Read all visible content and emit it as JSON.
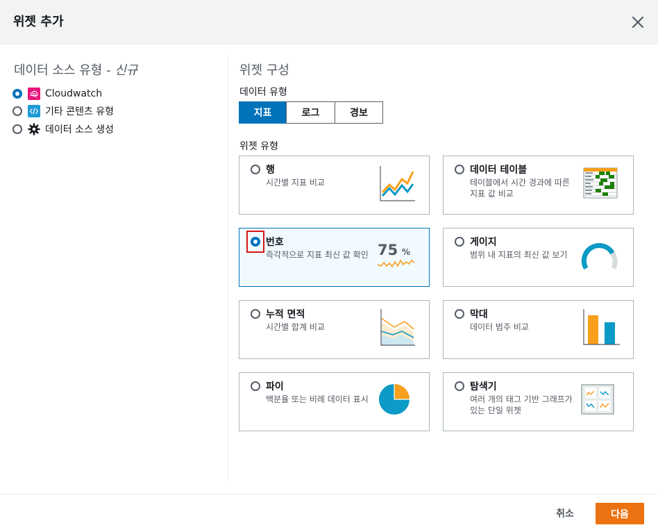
{
  "modal": {
    "title": "위젯 추가",
    "close_icon": "close-icon"
  },
  "data_source": {
    "title": "데이터 소스 유형 - ",
    "title_em": "신규",
    "options": [
      {
        "label": "Cloudwatch",
        "icon": "cloudwatch-icon",
        "selected": true
      },
      {
        "label": "기타 콘텐츠 유형",
        "icon": "code-icon",
        "selected": false
      },
      {
        "label": "데이터 소스 생성",
        "icon": "gear-icon",
        "selected": false
      }
    ]
  },
  "config": {
    "title": "위젯 구성",
    "data_type_label": "데이터 유형",
    "data_types": [
      "지표",
      "로그",
      "경보"
    ],
    "selected_data_type": "지표",
    "widget_type_label": "위젯 유형",
    "widgets": [
      {
        "title": "행",
        "desc": "시간별 지표 비교",
        "icon": "line-chart-icon",
        "selected": false
      },
      {
        "title": "데이터 테이블",
        "desc": "테이블에서 시간 경과에 따른 지표 값 비교",
        "icon": "table-icon",
        "selected": false
      },
      {
        "title": "번호",
        "desc": "즉각적으로 지표 최신 값 확인",
        "icon": "number-icon",
        "selected": true,
        "value": "75",
        "unit": "%"
      },
      {
        "title": "게이지",
        "desc": "범위 내 지표의 최신 값 보기",
        "icon": "gauge-icon",
        "selected": false
      },
      {
        "title": "누적 면적",
        "desc": "시간별 합계 비교",
        "icon": "stacked-area-icon",
        "selected": false
      },
      {
        "title": "막대",
        "desc": "데이터 범주 비교",
        "icon": "bar-chart-icon",
        "selected": false
      },
      {
        "title": "파이",
        "desc": "백분율 또는 비례 데이터 표시",
        "icon": "pie-chart-icon",
        "selected": false
      },
      {
        "title": "탐색기",
        "desc": "여러 개의 태그 기반 그래프가 있는 단일 위젯",
        "icon": "explorer-icon",
        "selected": false
      }
    ]
  },
  "footer": {
    "cancel": "취소",
    "next": "다음"
  },
  "colors": {
    "accent": "#0073bb",
    "primary_button": "#ec7211",
    "highlight": "#d91515",
    "chart_orange": "#f89f1b",
    "chart_blue": "#0c9ac6"
  }
}
